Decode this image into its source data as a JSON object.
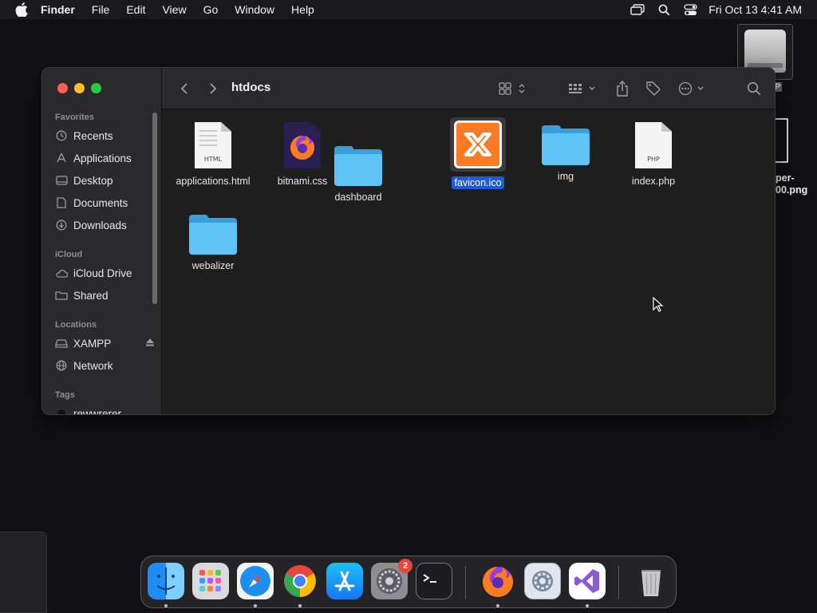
{
  "menubar": {
    "app_name": "Finder",
    "menus": [
      "File",
      "Edit",
      "View",
      "Go",
      "Window",
      "Help"
    ],
    "clock": "Fri Oct 13  4:41 AM"
  },
  "desktop": {
    "file_label": "per-\n00.png",
    "drive_badge": "P"
  },
  "finder": {
    "title": "htdocs",
    "sidebar": {
      "favorites_heading": "Favorites",
      "favorites": [
        "Recents",
        "Applications",
        "Desktop",
        "Documents",
        "Downloads"
      ],
      "icloud_heading": "iCloud",
      "icloud": [
        "iCloud Drive",
        "Shared"
      ],
      "locations_heading": "Locations",
      "locations": [
        "XAMPP",
        "Network"
      ],
      "tags_heading": "Tags",
      "tags": [
        "rewwrerer"
      ]
    },
    "files": [
      {
        "name": "applications.html",
        "kind": "html-doc",
        "tag": "HTML"
      },
      {
        "name": "bitnami.css",
        "kind": "firefox-doc"
      },
      {
        "name": "dashboard",
        "kind": "folder"
      },
      {
        "name": "favicon.ico",
        "kind": "xampp-icon",
        "selected": true
      },
      {
        "name": "img",
        "kind": "folder"
      },
      {
        "name": "index.php",
        "kind": "php-doc",
        "tag": "PHP"
      },
      {
        "name": "webalizer",
        "kind": "folder"
      }
    ]
  },
  "dock": {
    "apps": [
      "Finder",
      "Launchpad",
      "Safari",
      "Chrome",
      "App Store",
      "System Settings",
      "Terminal",
      "Firefox",
      "Xcode Settings",
      "Visual Studio"
    ],
    "settings_badge": "2",
    "trash": "Trash"
  },
  "colors": {
    "selection": "#1f5bd6",
    "folder": "#5dc4f5",
    "close": "#fe5f57",
    "minimize": "#febc2e",
    "zoom": "#28c840"
  }
}
